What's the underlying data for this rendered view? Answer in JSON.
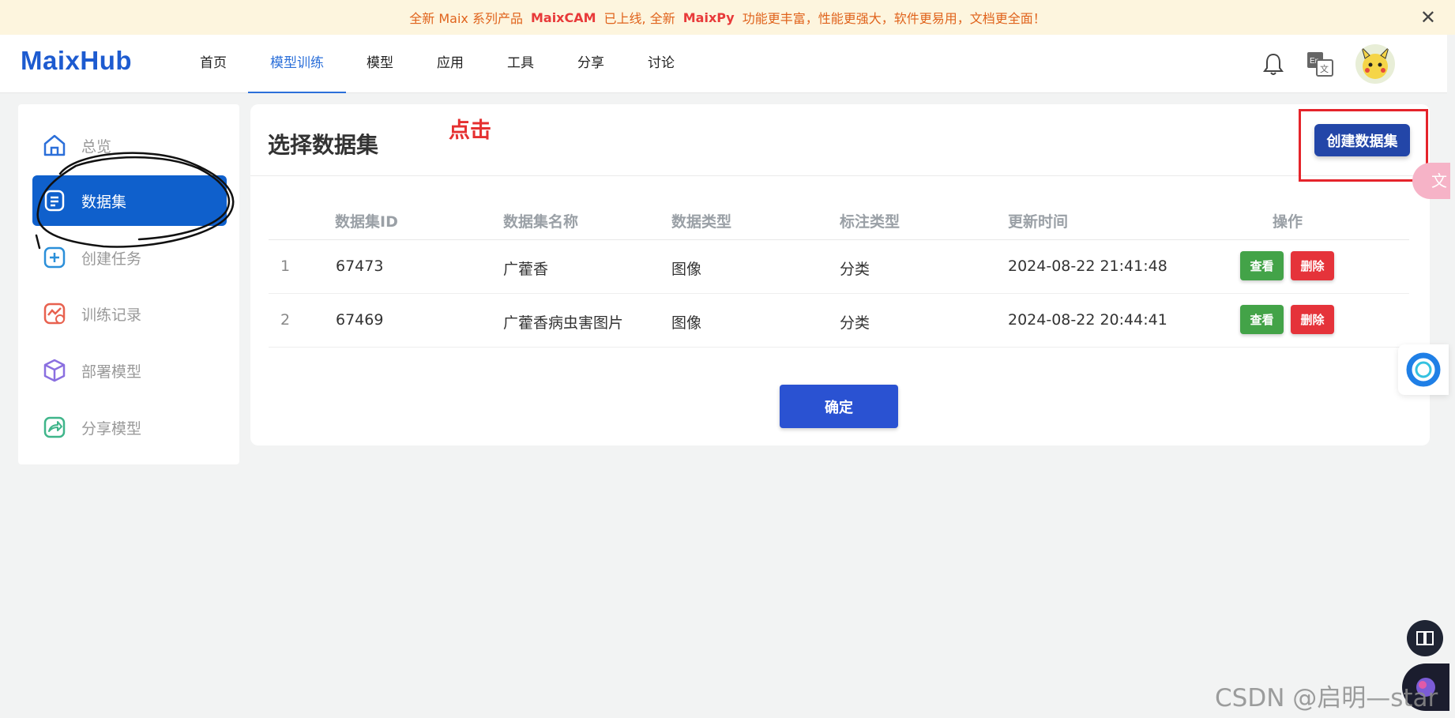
{
  "announcement": {
    "prefix": "全新 Maix 系列产品",
    "product1": "MaixCAM",
    "middle": "已上线, 全新",
    "product2": "MaixPy",
    "suffix": "功能更丰富，性能更强大，软件更易用，文档更全面！",
    "close": "✕"
  },
  "nav": {
    "logo": "MaixHub",
    "items": [
      "首页",
      "模型训练",
      "模型",
      "应用",
      "工具",
      "分享",
      "讨论"
    ],
    "active": "模型训练"
  },
  "sidebar": {
    "items": [
      "总览",
      "数据集",
      "创建任务",
      "训练记录",
      "部署模型",
      "分享模型"
    ],
    "active": "数据集"
  },
  "panel": {
    "title": "选择数据集",
    "annotation": "点击",
    "create_button": "创建数据集",
    "confirm_button": "确定"
  },
  "table": {
    "headers": [
      "数据集ID",
      "数据集名称",
      "数据类型",
      "标注类型",
      "更新时间",
      "操作"
    ],
    "rows": [
      {
        "index": "1",
        "id": "67473",
        "name": "广藿香",
        "data_type": "图像",
        "label_type": "分类",
        "updated": "2024-08-22 21:41:48",
        "view": "查看",
        "delete": "删除"
      },
      {
        "index": "2",
        "id": "67469",
        "name": "广藿香病虫害图片",
        "data_type": "图像",
        "label_type": "分类",
        "updated": "2024-08-22 20:44:41",
        "view": "查看",
        "delete": "删除"
      }
    ]
  },
  "watermark": "CSDN @启明—star",
  "colors": {
    "brand": "#1d5bd0",
    "active_side": "#0f60cc",
    "create_button": "#2346a8",
    "confirm": "#2a52d2",
    "view": "#43a348",
    "delete": "#e5333a",
    "annotation": "#e53030"
  }
}
